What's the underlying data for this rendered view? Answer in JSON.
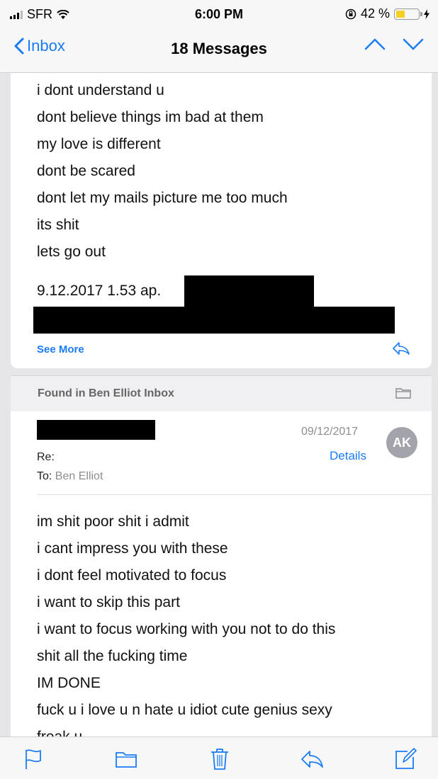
{
  "status": {
    "carrier": "SFR",
    "time": "6:00 PM",
    "battery_text": "42 %",
    "battery_level": 0.42
  },
  "nav": {
    "back_label": "Inbox",
    "title": "18 Messages"
  },
  "message1": {
    "lines": [
      "i dont understand u",
      "dont believe things im bad at them",
      "my love is different",
      "dont be scared",
      "dont let my mails picture me too much",
      "its shit",
      "lets go out"
    ],
    "quote_header": "9.12.2017 1.53 ap.",
    "see_more": "See More"
  },
  "found_in": {
    "label": "Found in Ben Elliot  Inbox"
  },
  "message2": {
    "date": "09/12/2017",
    "details": "Details",
    "avatar_initials": "AK",
    "subject_label": "Re:",
    "to_label": "To:",
    "to_value": "Ben Elliot",
    "lines": [
      "im shit poor shit i admit",
      "i cant impress you with these",
      "i dont feel motivated to focus",
      "i want to skip this part",
      "i want to focus working with you not to do this",
      "shit all the fucking time",
      "IM DONE",
      "fuck u i love u n hate u idiot cute genius sexy",
      "freak u"
    ]
  },
  "colors": {
    "accent": "#1a7cf5"
  },
  "toolbar": {
    "icons": [
      "flag-icon",
      "folder-icon",
      "trash-icon",
      "reply-icon",
      "compose-icon"
    ]
  }
}
